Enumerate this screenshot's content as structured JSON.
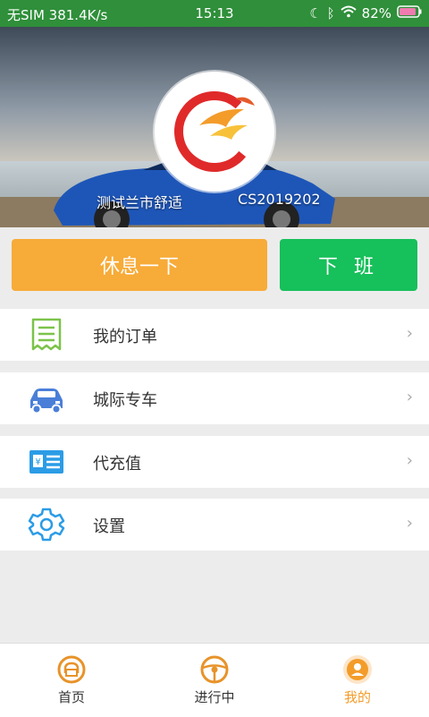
{
  "status_bar": {
    "carrier": "无SIM",
    "speed": "381.4K/s",
    "time": "15:13",
    "battery": "82%"
  },
  "profile": {
    "name": "测试兰市舒适",
    "code": "CS2019202"
  },
  "actions": {
    "rest_label": "休息一下",
    "off_label": "下 班"
  },
  "menu": [
    {
      "label": "我的订单",
      "icon": "receipt-icon"
    },
    {
      "label": "城际专车",
      "icon": "car-icon"
    },
    {
      "label": "代充值",
      "icon": "recharge-card-icon"
    },
    {
      "label": "设置",
      "icon": "gear-icon"
    }
  ],
  "tabs": [
    {
      "label": "首页",
      "icon": "home-icon"
    },
    {
      "label": "进行中",
      "icon": "steering-wheel-icon"
    },
    {
      "label": "我的",
      "icon": "profile-icon",
      "active": true
    }
  ],
  "colors": {
    "status_bar": "#2f8f3a",
    "rest_button": "#f7ab38",
    "off_button": "#16c05a",
    "active_tab": "#f39c2a"
  }
}
